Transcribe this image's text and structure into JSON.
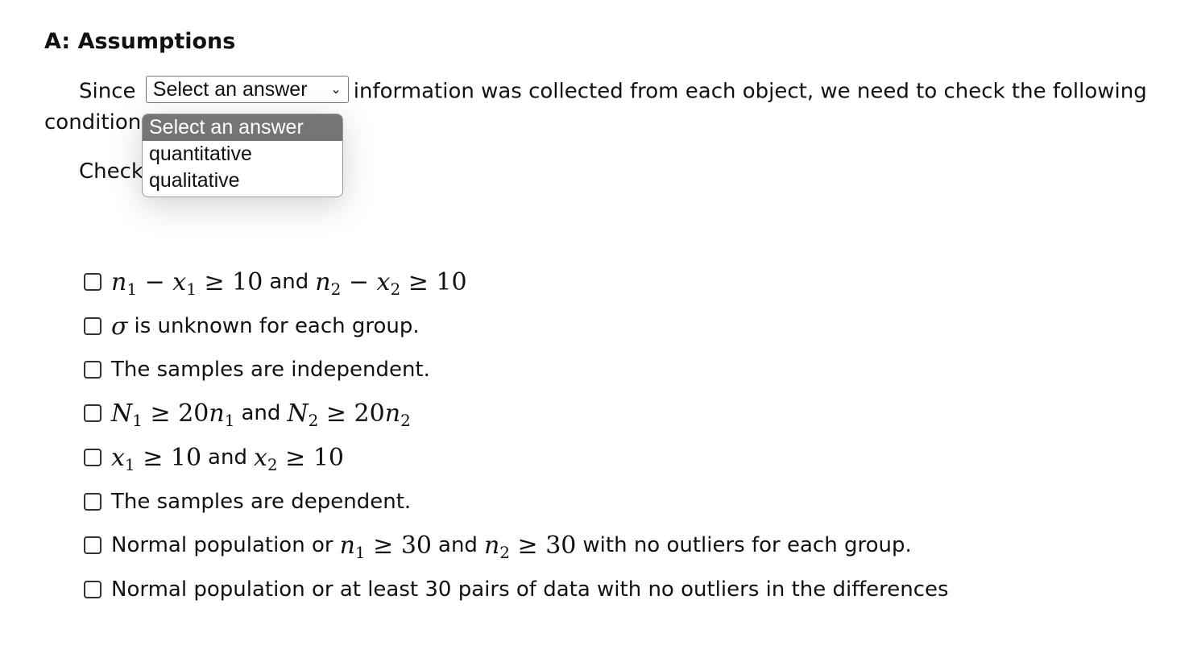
{
  "heading": "A: Assumptions",
  "sentence": {
    "prefix": "Since",
    "suffix": "information was collected from each object, we need to check the following",
    "continued": "conditions:"
  },
  "select": {
    "value": "Select an answer",
    "options": [
      "Select an answer",
      "quantitative",
      "qualitative"
    ]
  },
  "check_prefix": "Check",
  "conditions": [
    {
      "word": "and"
    },
    {
      "text": "is unknown for each group."
    },
    {
      "text": "The samples are independent."
    },
    {
      "word": "and"
    },
    {
      "word": "and"
    },
    {
      "text": "The samples are dependent."
    },
    {
      "pre": "Normal population or",
      "word": "and",
      "post": "with no outliers for each group."
    },
    {
      "text": "Normal population or at least 30 pairs of data with no outliers in the differences"
    }
  ]
}
